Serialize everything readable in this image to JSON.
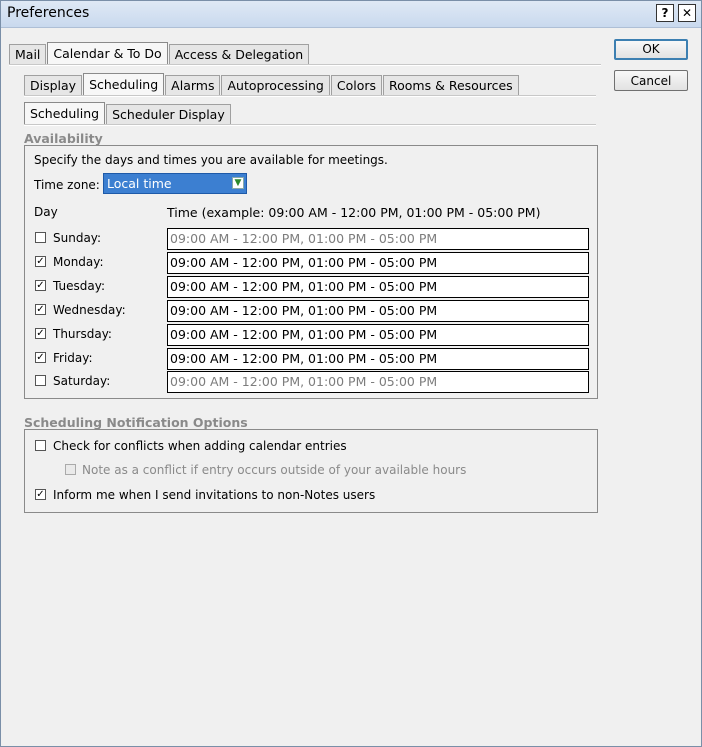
{
  "window": {
    "title": "Preferences",
    "help_btn": "?",
    "close_btn": "✕"
  },
  "main_tabs": [
    "Mail",
    "Calendar & To Do",
    "Access & Delegation"
  ],
  "sub_tabs": [
    "Display",
    "Scheduling",
    "Alarms",
    "Autoprocessing",
    "Colors",
    "Rooms & Resources"
  ],
  "inner_tabs": [
    "Scheduling",
    "Scheduler Display"
  ],
  "buttons": {
    "ok": "OK",
    "cancel": "Cancel"
  },
  "availability": {
    "label": "Availability",
    "intro": "Specify the days and times you are available for meetings.",
    "timezone_label": "Time zone:",
    "timezone_value": "Local time",
    "day_header": "Day",
    "time_header": "Time (example: 09:00 AM - 12:00 PM, 01:00 PM - 05:00 PM)",
    "days": [
      {
        "name": "Sunday:",
        "checked": "",
        "time": "09:00 AM - 12:00 PM, 01:00 PM - 05:00 PM"
      },
      {
        "name": "Monday:",
        "checked": "✓",
        "time": "09:00 AM - 12:00 PM, 01:00 PM - 05:00 PM"
      },
      {
        "name": "Tuesday:",
        "checked": "✓",
        "time": "09:00 AM - 12:00 PM, 01:00 PM - 05:00 PM"
      },
      {
        "name": "Wednesday:",
        "checked": "✓",
        "time": "09:00 AM - 12:00 PM, 01:00 PM - 05:00 PM"
      },
      {
        "name": "Thursday:",
        "checked": "✓",
        "time": "09:00 AM - 12:00 PM, 01:00 PM - 05:00 PM"
      },
      {
        "name": "Friday:",
        "checked": "✓",
        "time": "09:00 AM - 12:00 PM, 01:00 PM - 05:00 PM"
      },
      {
        "name": "Saturday:",
        "checked": "",
        "time": "09:00 AM - 12:00 PM, 01:00 PM - 05:00 PM"
      }
    ]
  },
  "notifications": {
    "label": "Scheduling Notification Options",
    "conflicts": {
      "text": "Check for conflicts when adding calendar entries",
      "checked": ""
    },
    "outside_hours": {
      "text": "Note as a conflict if entry occurs outside of your available hours",
      "checked": ""
    },
    "invitations": {
      "text": "Inform me when I send invitations to non-Notes users",
      "checked": "✓"
    }
  }
}
